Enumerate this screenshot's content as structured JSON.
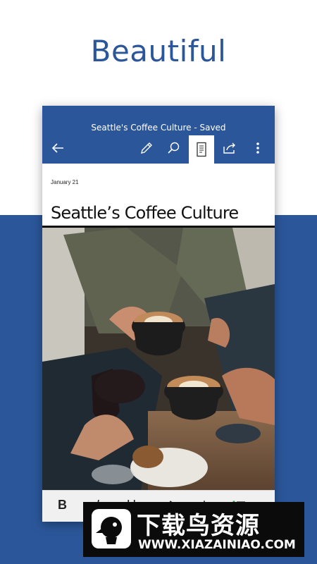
{
  "promo": {
    "headline": "Beautiful"
  },
  "app": {
    "document_status": "Seattle's Coffee Culture - Saved",
    "toolbar": {
      "back_icon": "back-arrow-icon",
      "edit_icon": "pencil-icon",
      "search_icon": "search-icon",
      "reading_view_icon": "mobile-view-icon",
      "share_icon": "share-icon",
      "more_icon": "more-vertical-icon"
    },
    "document": {
      "date": "January 21",
      "title": "Seattle’s Coffee Culture",
      "image": "photo of hands toasting with coffee cups and a glass"
    },
    "format_bar": {
      "bold_label": "B",
      "italic_label": "I",
      "underline_label": "U"
    }
  },
  "watermark": {
    "title": "下载鸟资源",
    "url": "WWW.XIAZAINIAO.COM"
  },
  "colors": {
    "brand_blue": "#2b579a",
    "white": "#ffffff"
  }
}
